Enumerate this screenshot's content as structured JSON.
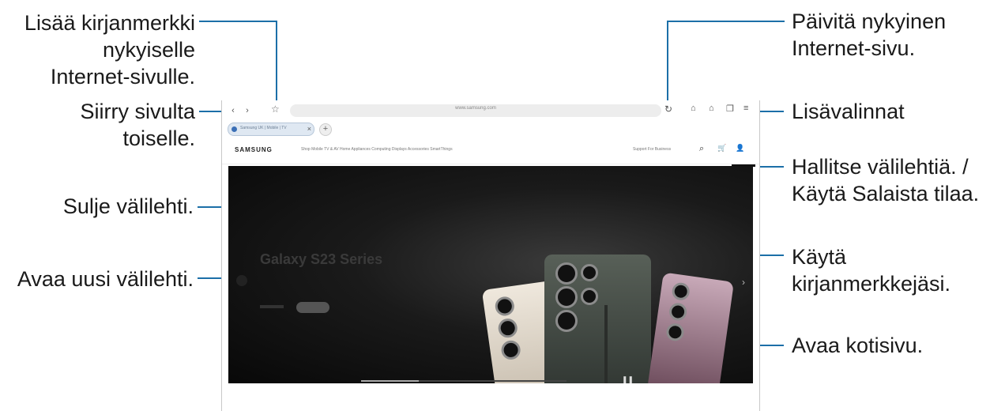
{
  "callouts": {
    "bookmark": [
      "Lisää kirjanmerkki",
      "nykyiselle",
      "Internet-sivulle."
    ],
    "navigate": [
      "Siirry sivulta",
      "toiselle."
    ],
    "close_tab": "Sulje välilehti.",
    "new_tab": "Avaa uusi välilehti.",
    "refresh": [
      "Päivitä nykyinen",
      "Internet-sivu."
    ],
    "more_options": "Lisävalinnat",
    "manage_tabs": [
      "Hallitse välilehtiä. /",
      "Käytä Salaista tilaa."
    ],
    "bookmarks": [
      "Käytä",
      "kirjanmerkkejäsi."
    ],
    "home": "Avaa kotisivu."
  },
  "browser": {
    "back_icon": "‹",
    "forward_icon": "›",
    "bookmark_icon": "☆",
    "url": "www.samsung.com",
    "reload_icon": "↻",
    "home_icon": "⌂",
    "bookmarks_icon": "⌂",
    "tabs_icon": "❐",
    "menu_icon": "≡",
    "tab_title": "Samsung UK | Mobile | TV",
    "tab_close_icon": "×",
    "new_tab_icon": "+",
    "site_logo": "SAMSUNG",
    "site_menu": "Shop   Mobile   TV & AV   Home Appliances   Computing   Displays   Accessories   SmartThings",
    "site_support": "Support   For Business",
    "site_search_icon": "⌕",
    "site_cart_icon": "🛒",
    "site_user_icon": "👤",
    "hero_title": "Galaxy S23 Series",
    "pause_icon": "❚❚",
    "hero_next_icon": "›",
    "slide_progress": 0.28
  }
}
